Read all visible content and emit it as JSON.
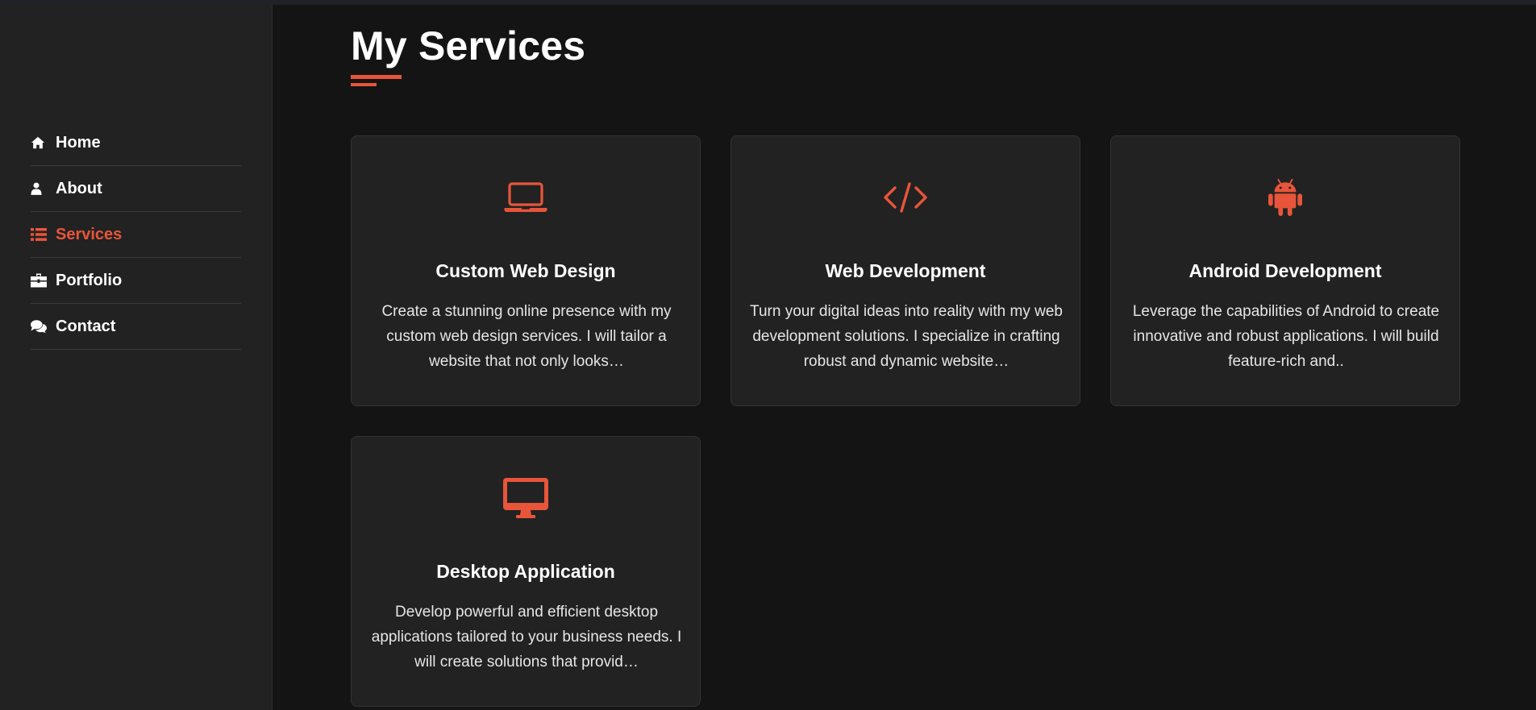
{
  "nav": {
    "items": [
      {
        "label": "Home",
        "icon": "home-icon",
        "active": false
      },
      {
        "label": "About",
        "icon": "user-icon",
        "active": false
      },
      {
        "label": "Services",
        "icon": "list-icon",
        "active": true
      },
      {
        "label": "Portfolio",
        "icon": "briefcase-icon",
        "active": false
      },
      {
        "label": "Contact",
        "icon": "comments-icon",
        "active": false
      }
    ]
  },
  "main": {
    "title": "My Services"
  },
  "services": [
    {
      "icon": "laptop-icon",
      "title": "Custom Web Design",
      "text": "Create a stunning online presence with my custom web design services. I will tailor a website that not only looks…"
    },
    {
      "icon": "code-icon",
      "title": "Web Development",
      "text": "Turn your digital ideas into reality with my web development solutions. I specialize in crafting robust and dynamic website…"
    },
    {
      "icon": "android-icon",
      "title": "Android Development",
      "text": "Leverage the capabilities of Android to create innovative and robust applications. I will build feature-rich and.."
    },
    {
      "icon": "desktop-icon",
      "title": "Desktop Application",
      "text": "Develop powerful and efficient desktop applications tailored to your business needs. I will create solutions that provid…"
    }
  ],
  "colors": {
    "accent": "#e8553a",
    "background": "#141414",
    "sidebar": "#222222",
    "card": "#222222"
  }
}
